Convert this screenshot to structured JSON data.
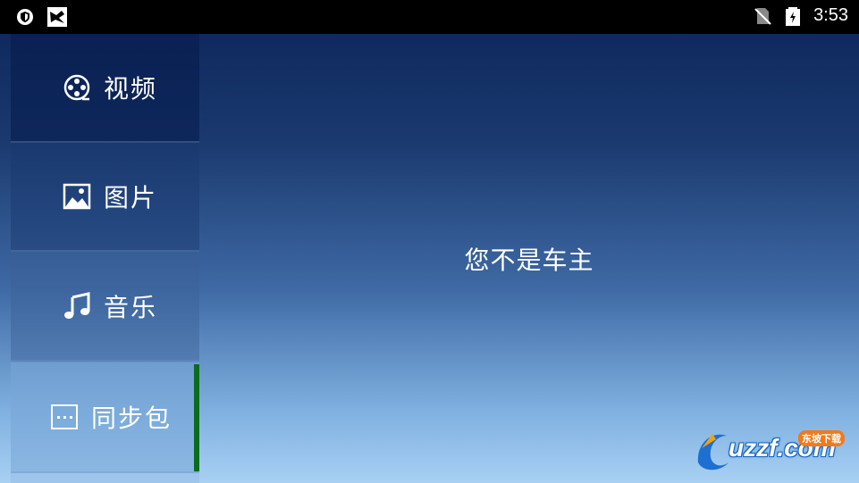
{
  "status_bar": {
    "time": "3:53",
    "left_icons": [
      "shield-icon",
      "app-notification-icon"
    ],
    "right_icons": [
      "no-sim-icon",
      "battery-charging-icon"
    ]
  },
  "sidebar": {
    "items": [
      {
        "label": "视频",
        "icon": "film-reel-icon",
        "active": false
      },
      {
        "label": "图片",
        "icon": "image-icon",
        "active": false
      },
      {
        "label": "音乐",
        "icon": "music-note-icon",
        "active": false
      },
      {
        "label": "同步包",
        "icon": "more-dots-icon",
        "active": true
      }
    ],
    "active_indicator_color": "#0b6b1f"
  },
  "main": {
    "message": "您不是车主"
  },
  "watermark": {
    "text": "uzzf.com",
    "badge": "东坡下载"
  }
}
